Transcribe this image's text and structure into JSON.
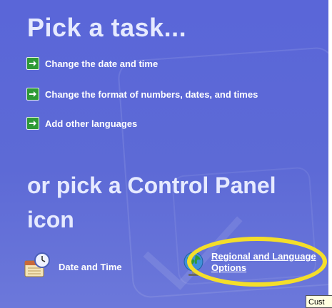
{
  "header": {
    "title": "Pick a task..."
  },
  "tasks": [
    {
      "label": "Change the date and time",
      "icon": "green-arrow-icon"
    },
    {
      "label": "Change the format of numbers, dates, and times",
      "icon": "green-arrow-icon"
    },
    {
      "label": "Add other languages",
      "icon": "green-arrow-icon"
    }
  ],
  "control_panel": {
    "subtitle": "or pick a Control Panel icon",
    "icons": [
      {
        "label": "Date and Time",
        "icon": "date-time-icon"
      },
      {
        "label": "Regional and Language Options",
        "icon": "globe-icon"
      }
    ]
  },
  "tooltip": {
    "text": "Cust"
  },
  "colors": {
    "panel_background": "#5a66d8",
    "title_text": "#e6eaff",
    "task_arrow": "#2e9a36",
    "highlight": "#f4de2a"
  }
}
